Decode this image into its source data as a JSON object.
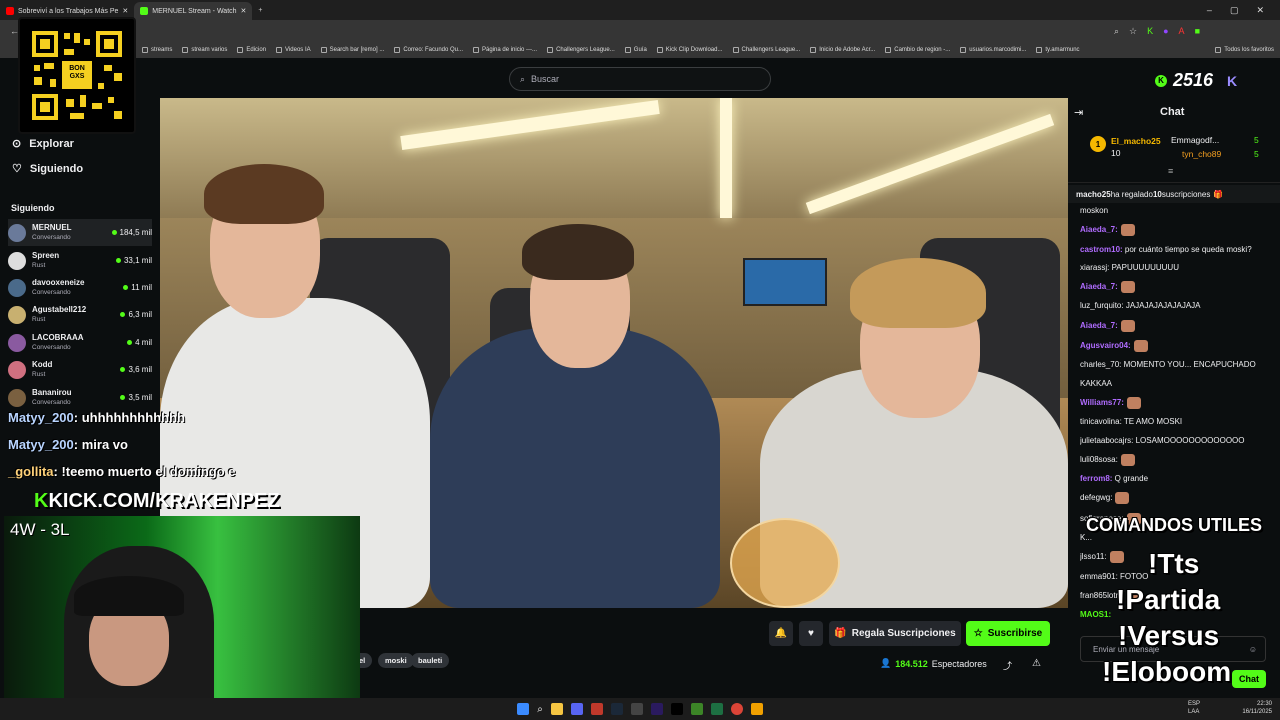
{
  "browser": {
    "tabs": [
      {
        "label": "Sobreviví a los Trabajos Más Pe",
        "color": "#ff0000"
      },
      {
        "label": "MERNUEL Stream - Watch",
        "color": "#53fc18"
      }
    ],
    "bookmarks": [
      "streams",
      "stream varios",
      "Edicion",
      "Videos IA",
      "Search bar [remo] ...",
      "Correo: Facundo Qu...",
      "Página de inicio ---...",
      "Challengers League...",
      "Guía",
      "Kick Clip Download...",
      "Challengers League...",
      "Inicio de Adobe Acr...",
      "Cambio de region -...",
      "usuarios.marcodimi...",
      "ty.amarmunc",
      "Todos los favoritos"
    ]
  },
  "header": {
    "search_placeholder": "Buscar",
    "coins": "2516"
  },
  "sidebar": {
    "nav": [
      {
        "label": "Explorar",
        "icon": "compass-icon"
      },
      {
        "label": "Siguiendo",
        "icon": "heart-icon"
      }
    ],
    "following_title": "Siguiendo",
    "channels": [
      {
        "name": "MERNUEL",
        "game": "Conversando",
        "viewers": "184,5 mil"
      },
      {
        "name": "Spreen",
        "game": "Rust",
        "viewers": "33,1 mil"
      },
      {
        "name": "davooxeneize",
        "game": "Conversando",
        "viewers": "11 mil"
      },
      {
        "name": "Agustabell212",
        "game": "Rust",
        "viewers": "6,3 mil"
      },
      {
        "name": "LACOBRAAA",
        "game": "Conversando",
        "viewers": "4 mil"
      },
      {
        "name": "Kodd",
        "game": "Rust",
        "viewers": "3,6 mil"
      },
      {
        "name": "Bananirou",
        "game": "Conversando",
        "viewers": "3,5 mil"
      }
    ]
  },
  "overlay": {
    "qr_label": "BON GXS",
    "chat_lines": [
      {
        "name": "Matyy_200",
        "text": ": uhhhhhhhhhhhh"
      },
      {
        "name": "Matyy_200",
        "text": ": mira vo"
      },
      {
        "name": "_gollita",
        "text": ": !teemo muerto el domingo e"
      }
    ],
    "kick_url": "KICK.COM/KRAKENPEZ",
    "score": "4W - 3L",
    "commands": [
      "COMANDOS UTILES",
      "!Tts",
      "!Partida",
      "!Versus",
      "!Eloboom"
    ]
  },
  "stream": {
    "actions": {
      "gift_label": "Regala Suscripciones",
      "subscribe_label": "Suscribirse"
    },
    "tags": [
      "el",
      "moski",
      "bauleti"
    ],
    "viewers_count": "184.512",
    "viewers_label": "Espectadores"
  },
  "chat": {
    "title": "Chat",
    "gifters": [
      {
        "name": "El_macho25",
        "count": "10"
      },
      {
        "name": "Emmagodf...",
        "count": "5"
      },
      {
        "name": "tyn_cho89",
        "count": "5"
      }
    ],
    "banner": {
      "user": "macho25",
      "text": " ha regalado ",
      "count": "10",
      "tail": " suscripciones"
    },
    "messages": [
      {
        "user": "",
        "text": "moskon",
        "color": "white"
      },
      {
        "user": "Aiaeda_7:",
        "text": "",
        "color": "purple",
        "emote": true
      },
      {
        "user": "castrom10:",
        "text": " por cuánto tiempo se queda moski?",
        "color": "purple"
      },
      {
        "user": "xiarassj:",
        "text": " PAPUUUUUUUUU",
        "color": "white"
      },
      {
        "user": "Aiaeda_7:",
        "text": "",
        "color": "purple",
        "emote": true
      },
      {
        "user": "luz_furquito:",
        "text": " JAJAJAJAJAJAJAJA",
        "color": "white"
      },
      {
        "user": "Aiaeda_7:",
        "text": "",
        "color": "purple",
        "emote": true
      },
      {
        "user": "Agusvairo04:",
        "text": "",
        "color": "purple",
        "emote": true
      },
      {
        "user": "charles_70:",
        "text": " MOMENTO YOU... ENCAPUCHADO",
        "color": "white"
      },
      {
        "user": "",
        "text": "KAKKAA",
        "color": "white"
      },
      {
        "user": "Williams77:",
        "text": "",
        "color": "purple",
        "emote": true
      },
      {
        "user": "tinicavolina:",
        "text": " TE AMO MOSKI",
        "color": "white"
      },
      {
        "user": "julietaabocajrs:",
        "text": " LOSAMOOOOOOOOOOOOO",
        "color": "white"
      },
      {
        "user": "luli08sosa:",
        "text": "",
        "color": "white",
        "emote": true
      },
      {
        "user": "ferrom8:",
        "text": " Q grande",
        "color": "purple"
      },
      {
        "user": "defegwg:",
        "text": "",
        "color": "white",
        "emote": true
      },
      {
        "user": "sofigranese:",
        "text": "",
        "color": "white",
        "emote": true
      },
      {
        "user": "K...",
        "text": "",
        "color": "white"
      },
      {
        "user": "jlsso11:",
        "text": "",
        "color": "white",
        "emote": true
      },
      {
        "user": "emma901:",
        "text": " FOTOO",
        "color": "white"
      },
      {
        "user": "fran865lotm:",
        "text": "",
        "color": "white",
        "emote": true
      },
      {
        "user": "MAOS1:",
        "text": "",
        "color": "green"
      }
    ],
    "input_placeholder": "Enviar un mensaje",
    "chat_button": "Chat"
  },
  "taskbar": {
    "lang": "ESP",
    "region": "LAA",
    "time": "22:30",
    "date": "16/11/2025"
  }
}
